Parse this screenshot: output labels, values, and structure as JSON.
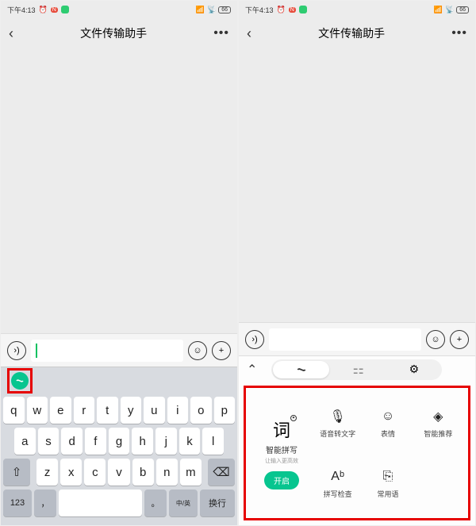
{
  "status": {
    "time": "下午4:13",
    "battery": "66"
  },
  "header": {
    "title": "文件传输助手"
  },
  "keyboard": {
    "row1": [
      "q",
      "w",
      "e",
      "r",
      "t",
      "y",
      "u",
      "i",
      "o",
      "p"
    ],
    "row2": [
      "a",
      "s",
      "d",
      "f",
      "g",
      "h",
      "j",
      "k",
      "l"
    ],
    "row3": [
      "z",
      "x",
      "c",
      "v",
      "b",
      "n",
      "m"
    ],
    "num_key": "123",
    "comma": "，",
    "period": "。",
    "lang": "中/英",
    "enter": "换行"
  },
  "panel": {
    "smart": {
      "char": "词",
      "label": "智能拼写",
      "sub": "让输入更高效",
      "open": "开启"
    },
    "features": [
      {
        "label": "语音转文字",
        "icon": "mic"
      },
      {
        "label": "表情",
        "icon": "smile"
      },
      {
        "label": "智能推荐",
        "icon": "stack"
      },
      {
        "label": "拼写检查",
        "icon": "check"
      },
      {
        "label": "常用语",
        "icon": "phrase"
      }
    ]
  }
}
